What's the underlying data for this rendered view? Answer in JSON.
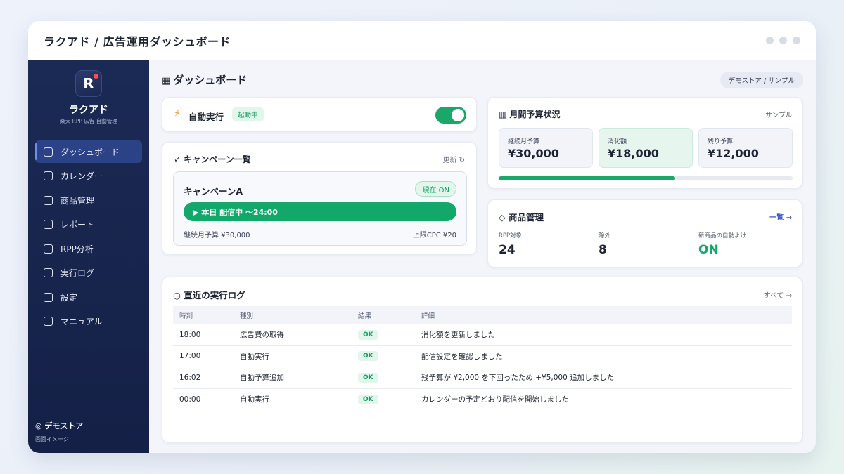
{
  "window": {
    "title": "ラクアド / 広告運用ダッシュボード"
  },
  "sidebar": {
    "logo_letter": "R",
    "brand": "ラクアド",
    "brand_sub": "楽天 RPP 広告 自動管理",
    "items": [
      {
        "label": "ダッシュボード",
        "active": true
      },
      {
        "label": "カレンダー"
      },
      {
        "label": "商品管理"
      },
      {
        "label": "レポート"
      },
      {
        "label": "RPP分析"
      },
      {
        "label": "実行ログ"
      },
      {
        "label": "設定"
      },
      {
        "label": "マニュアル"
      }
    ],
    "store": "◎ デモストア",
    "store_sub": "画面イメージ"
  },
  "header": {
    "title": "ダッシュボード",
    "store_pill": "デモストア / サンプル"
  },
  "auto_exec": {
    "title": "自動実行",
    "badge": "起動中",
    "enabled": true
  },
  "campaigns": {
    "title": "キャンペーン一覧",
    "refresh": "更新 ↻",
    "items": [
      {
        "name": "キャンペーンA",
        "status": "現在 ON",
        "live": "▶ 本日 配信中 〜24:00",
        "budget": "継続月予算 ¥30,000",
        "cpc": "上限CPC ¥20"
      }
    ]
  },
  "budget": {
    "title": "月間予算状況",
    "sample": "サンプル",
    "stats": [
      {
        "label": "継続月予算",
        "value": "¥30,000"
      },
      {
        "label": "消化額",
        "value": "¥18,000"
      },
      {
        "label": "残り予算",
        "value": "¥12,000"
      }
    ],
    "progress": 0.6
  },
  "products": {
    "title": "◇ 商品管理",
    "link": "一覧 →",
    "cols": [
      {
        "label": "RPP対象",
        "value": "24"
      },
      {
        "label": "除外",
        "value": "8"
      },
      {
        "label": "新商品の自動よけ",
        "value": "ON"
      }
    ]
  },
  "log": {
    "title": "直近の実行ログ",
    "all": "すべて →",
    "headers": [
      "時刻",
      "種別",
      "結果",
      "詳細"
    ],
    "rows": [
      [
        "18:00",
        "広告費の取得",
        "OK",
        "消化額を更新しました"
      ],
      [
        "17:00",
        "自動実行",
        "OK",
        "配信設定を確認しました"
      ],
      [
        "16:02",
        "自動予算追加",
        "OK",
        "残予算が ¥2,000 を下回ったため +¥5,000 追加しました"
      ],
      [
        "00:00",
        "自動実行",
        "OK",
        "カレンダーの予定どおり配信を開始しました"
      ]
    ]
  },
  "colors": {
    "accent_green": "#17a86a",
    "sidebar_bg": "#1b2a55",
    "active_nav": "#2c4287",
    "link_blue": "#2f56c9"
  }
}
